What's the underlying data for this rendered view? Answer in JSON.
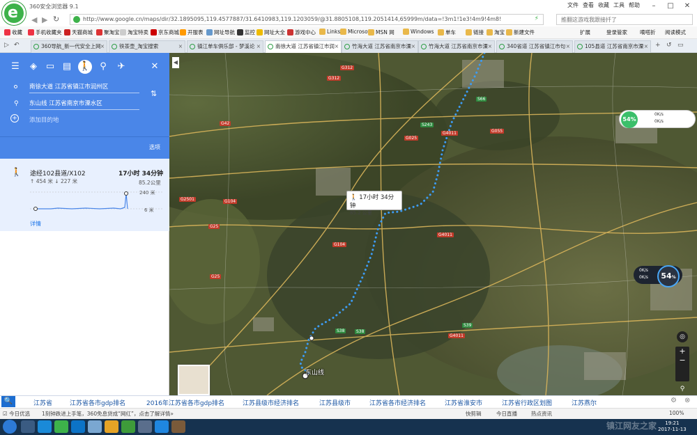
{
  "browser": {
    "title": "360安全浏览器 9.1",
    "menu": [
      "文件",
      "查看",
      "收藏",
      "工具",
      "帮助"
    ],
    "address": "http://www.google.cn/maps/dir/32.1895095,119.4577887/31.6410983,119.1203059/@31.8805108,119.2051414,65999m/data=!3m1!1e3!4m9!4m8!",
    "search_placeholder": "推翻这游戏我跟接扦了",
    "bookmarks": [
      "收藏",
      "手机收藏夹",
      "天猫商城",
      "聚淘宝",
      "淘宝特卖",
      "京东商城",
      "开服表",
      "网址导航",
      "监控",
      "网址大全",
      "游戏中心",
      "Links",
      "Microsoft",
      "MSN 网",
      "Windows",
      "单车",
      "链接",
      "淘宝",
      "新建文件"
    ],
    "bookmark_right": [
      "扩展",
      "登录管家",
      "嘀嗒折",
      "阅读模式"
    ],
    "tabs": [
      "360导航_新一代安全上网",
      "铁茶壶_淘宝搜索",
      "镇江单车俱乐部 - 梦溪论",
      "南徐大道 江苏省镇江市润",
      "竹海大道 江苏省南京市溧",
      "竹海大道 江苏省南京市溧",
      "340省道 江苏省镇江市句",
      "105县道 江苏省南京市溧"
    ],
    "active_tab": 3
  },
  "directions": {
    "origin": "南徐大道 江苏省镇江市润州区",
    "destination": "东山线 江苏省南京市溧水区",
    "add_destination": "添加目的地",
    "options": "选项",
    "route": {
      "via": "途经102县道/X102",
      "time": "17小时 34分钟",
      "distance": "85.2公里",
      "ascent": "454 米",
      "descent": "227 米",
      "elev_max": "240 米",
      "elev_min": "6 米",
      "details": "详情"
    },
    "modes": [
      "menu-icon",
      "best-icon",
      "car-icon",
      "transit-icon",
      "walk-icon",
      "bike-icon",
      "flight-icon"
    ]
  },
  "map": {
    "route_label_time": "17小时 34分钟",
    "route_label_dist": "85.2 公里",
    "end_label": "东山线",
    "gauge_top": "54",
    "gauge_top_unit": "%",
    "speed_up": "0K/s",
    "speed_down": "0K/s",
    "gauge_bottom": "54",
    "gauge_bottom_unit": "%",
    "roads": [
      "G312",
      "G42",
      "G312",
      "S243",
      "S66",
      "G025",
      "G4011",
      "G055",
      "G2501",
      "G104",
      "G25",
      "G4011",
      "G25",
      "G104",
      "S38",
      "S38",
      "G4011",
      "S39"
    ],
    "route_color": "#3d9cf5"
  },
  "suggestions": [
    "江苏省",
    "江苏省各市gdp排名",
    "2016年江苏省各市gdp排名",
    "江苏县级市经济排名",
    "江苏县级市",
    "江苏省各市经济排名",
    "江苏省淮安市",
    "江苏省行政区划图",
    "江苏燕尔"
  ],
  "status": {
    "left": "今日优选",
    "news": "1刻钟跌进上手笔，360免息贷成“网红”，点击了解详情»",
    "quickdl": "快剪辑",
    "live": "今日直播",
    "hot": "热点资讯",
    "zoom": "100%"
  },
  "taskbar": {
    "time": "19:21",
    "date": "2017-11-13",
    "watermark": "镇江网友之家"
  }
}
